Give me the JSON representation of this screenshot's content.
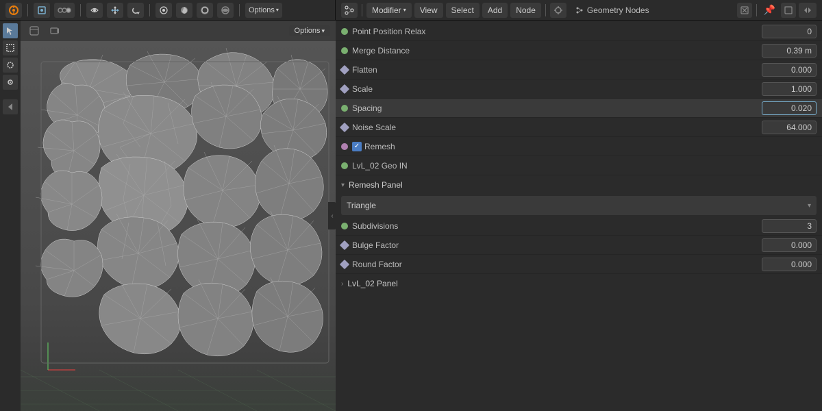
{
  "topbar": {
    "left": {
      "options_label": "Options",
      "tools": [
        "cursor",
        "box-select",
        "lasso",
        "tweak"
      ]
    },
    "right": {
      "menus": [
        "Modifier",
        "View",
        "Select",
        "Add",
        "Node"
      ],
      "modifier_dropdown": "Modifier",
      "title": "Geometry Nodes",
      "window_controls": [
        "pin",
        "maximize"
      ]
    }
  },
  "viewport": {
    "collapse_arrow": "‹",
    "header_tools": [
      "camera-icon",
      "material-icon",
      "overlay-icon",
      "gizmo-icon"
    ]
  },
  "properties": {
    "rows": [
      {
        "id": "point-pos-relax",
        "socket": "circle",
        "socket_color": "#7ab070",
        "label": "Point Position Relax",
        "value": "0",
        "has_field": true
      },
      {
        "id": "merge-distance",
        "socket": "circle",
        "socket_color": "#7ab070",
        "label": "Merge Distance",
        "value": "0.39 m",
        "has_field": true
      },
      {
        "id": "flatten",
        "socket": "diamond",
        "socket_color": "#a0a0c0",
        "label": "Flatten",
        "value": "0.000",
        "has_field": true
      },
      {
        "id": "scale",
        "socket": "diamond",
        "socket_color": "#a0a0c0",
        "label": "Scale",
        "value": "1.000",
        "has_field": true
      },
      {
        "id": "spacing",
        "socket": "circle",
        "socket_color": "#7ab070",
        "label": "Spacing",
        "value": "0.020",
        "has_field": true,
        "highlighted": true
      },
      {
        "id": "noise-scale",
        "socket": "diamond",
        "socket_color": "#a0a0c0",
        "label": "Noise Scale",
        "value": "64.000",
        "has_field": true
      },
      {
        "id": "remesh",
        "socket": "circle",
        "socket_color": "#b080b0",
        "label": "Remesh",
        "type": "checkbox",
        "checked": true
      },
      {
        "id": "lvl02-geo-in",
        "socket": "circle",
        "socket_color": "#7ab070",
        "label": "LvL_02 Geo IN",
        "type": "section"
      },
      {
        "id": "remesh-panel",
        "label": "Remesh Panel",
        "type": "subsection"
      },
      {
        "id": "triangle-dropdown",
        "label": "Triangle",
        "type": "dropdown"
      },
      {
        "id": "subdivisions",
        "socket": "circle",
        "socket_color": "#7ab070",
        "label": "Subdivisions",
        "value": "3",
        "has_field": true
      },
      {
        "id": "bulge-factor",
        "socket": "diamond",
        "socket_color": "#a0a0c0",
        "label": "Bulge Factor",
        "value": "0.000",
        "has_field": true
      },
      {
        "id": "round-factor",
        "socket": "diamond",
        "socket_color": "#a0a0c0",
        "label": "Round Factor",
        "value": "0.000",
        "has_field": true
      },
      {
        "id": "lvl02-panel",
        "label": "LvL_02 Panel",
        "type": "collapsed-section"
      }
    ],
    "socket_colors": {
      "green": "#7ab070",
      "purple": "#b080b0",
      "blue_gray": "#a0a0c0"
    }
  }
}
